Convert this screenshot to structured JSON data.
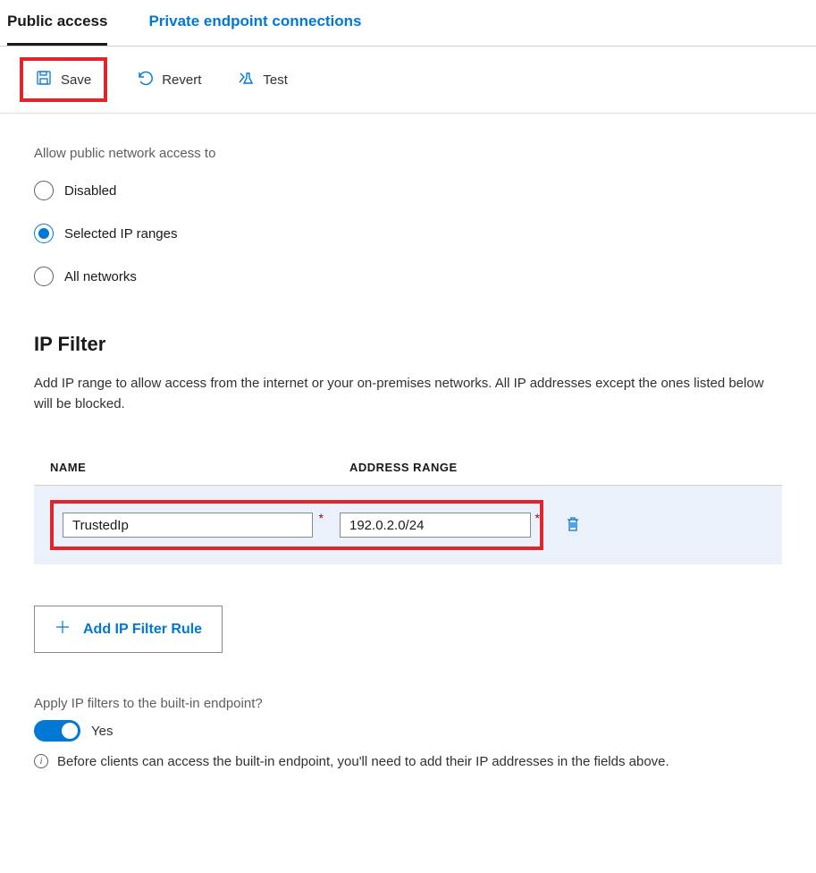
{
  "tabs": {
    "public": "Public access",
    "private": "Private endpoint connections"
  },
  "toolbar": {
    "save_label": "Save",
    "revert_label": "Revert",
    "test_label": "Test"
  },
  "access": {
    "title": "Allow public network access to",
    "options": [
      "Disabled",
      "Selected IP ranges",
      "All networks"
    ],
    "selected_index": 1
  },
  "ipfilter": {
    "heading": "IP Filter",
    "description": "Add IP range to allow access from the internet or your on-premises networks. All IP addresses except the ones listed below will be blocked.",
    "columns": {
      "name": "NAME",
      "address": "ADDRESS RANGE"
    },
    "rows": [
      {
        "name": "TrustedIp",
        "address_range": "192.0.2.0/24"
      }
    ],
    "add_button_label": "Add IP Filter Rule"
  },
  "builtin": {
    "label": "Apply IP filters to the built-in endpoint?",
    "value_label": "Yes",
    "info": "Before clients can access the built-in endpoint, you'll need to add their IP addresses in the fields above."
  }
}
